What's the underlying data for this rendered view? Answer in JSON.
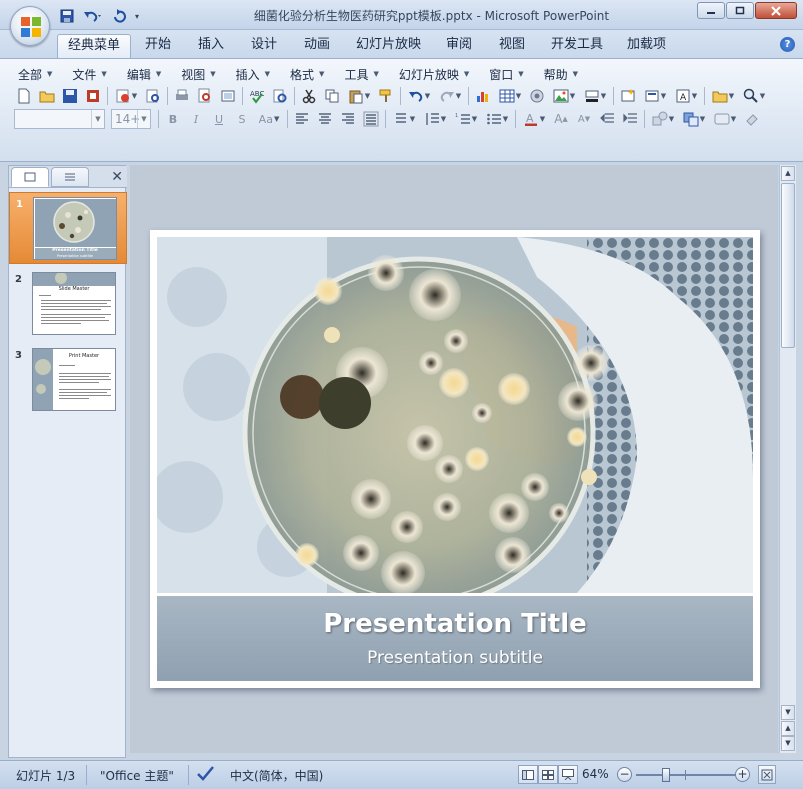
{
  "window": {
    "title": "细菌化验分析生物医药研究ppt模板.pptx - Microsoft PowerPoint",
    "controls": [
      "minimize",
      "maximize",
      "close"
    ]
  },
  "ribbon_tabs": [
    {
      "label": "经典菜单",
      "active": true
    },
    {
      "label": "开始"
    },
    {
      "label": "插入"
    },
    {
      "label": "设计"
    },
    {
      "label": "动画"
    },
    {
      "label": "幻灯片放映"
    },
    {
      "label": "审阅"
    },
    {
      "label": "视图"
    },
    {
      "label": "开发工具"
    },
    {
      "label": "加载项"
    }
  ],
  "classic_menu": [
    {
      "label": "全部"
    },
    {
      "label": "文件"
    },
    {
      "label": "编辑"
    },
    {
      "label": "视图"
    },
    {
      "label": "插入"
    },
    {
      "label": "格式"
    },
    {
      "label": "工具"
    },
    {
      "label": "幻灯片放映"
    },
    {
      "label": "窗口"
    },
    {
      "label": "帮助"
    }
  ],
  "format_bar": {
    "font_name": "",
    "font_size": "14+"
  },
  "slides_panel": {
    "slides": [
      {
        "number": "1",
        "selected": true,
        "thumb_title": "Presentation Title",
        "thumb_sub": "Presentation subtitle"
      },
      {
        "number": "2",
        "thumb_title": "Slide Master"
      },
      {
        "number": "3",
        "thumb_title": "Print Master"
      }
    ]
  },
  "slide": {
    "title": "Presentation Title",
    "subtitle": "Presentation subtitle"
  },
  "status": {
    "slide_counter": "幻灯片 1/3",
    "theme": "\"Office 主题\"",
    "language": "中文(简体，中国)",
    "zoom": "64%",
    "zoom_value": 64
  },
  "colors": {
    "accent_selected": "#e58a36",
    "ribbon": "#d7e3f2"
  }
}
